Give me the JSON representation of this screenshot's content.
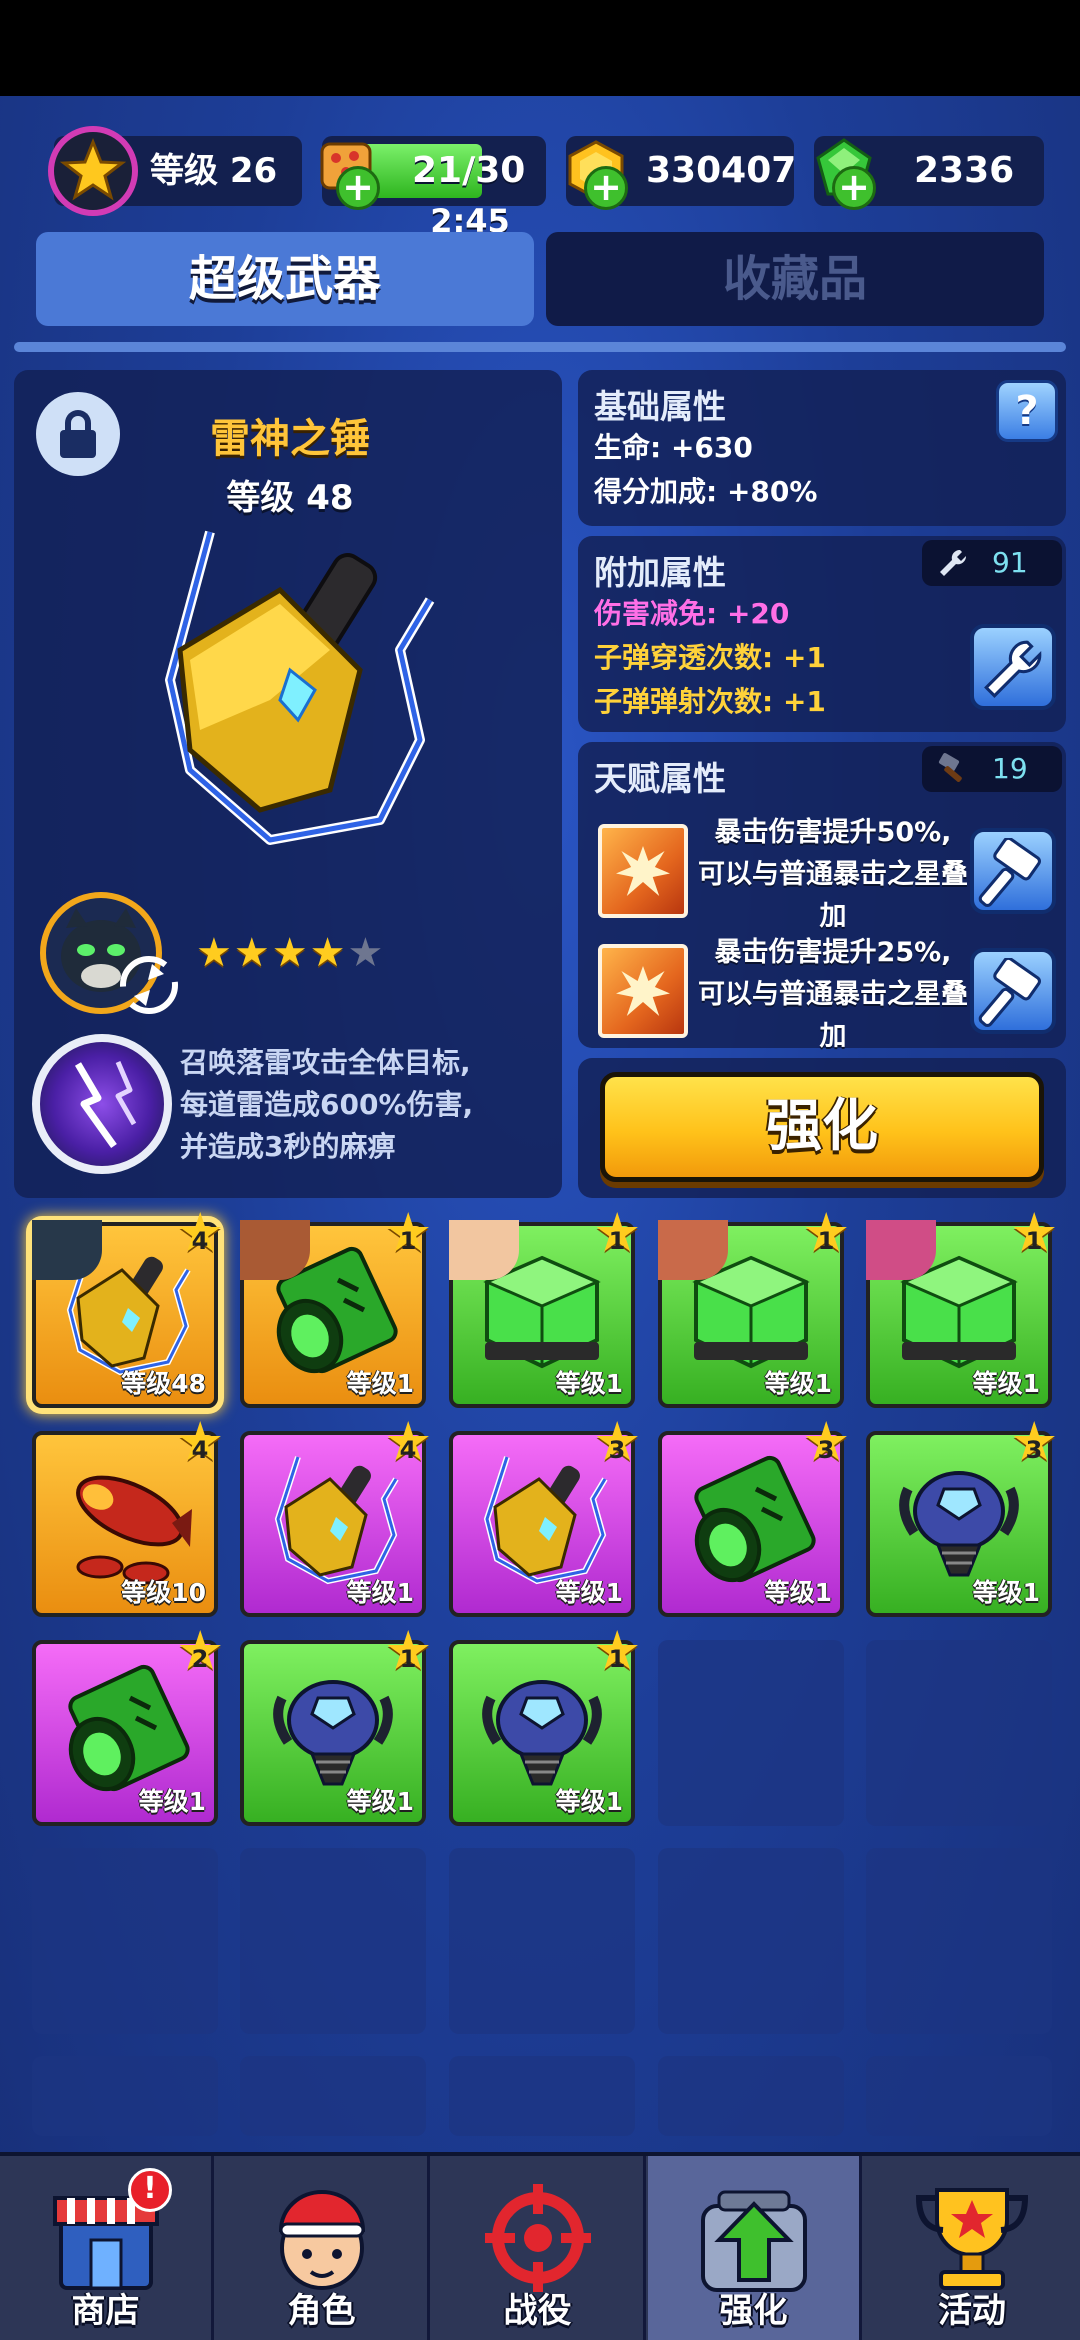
{
  "top_bar": {
    "player_level_label": "等级 26",
    "energy": "21/30",
    "energy_progress": 0.7,
    "energy_timer": "2:45",
    "gold": "330407",
    "gems": "2336"
  },
  "tabs": {
    "super_weapon": "超级武器",
    "collection": "收藏品"
  },
  "weapon": {
    "name": "雷神之锤",
    "level_label": "等级 48",
    "stars_filled": 4,
    "stars_total": 5,
    "skill_lines": [
      "召唤落雷攻击全体目标,",
      "每道雷造成600%伤害,",
      "并造成3秒的麻痹"
    ]
  },
  "base_attrs": {
    "title": "基础属性",
    "help_label": "?",
    "hp": "生命: +630",
    "score_bonus": "得分加成: +80%"
  },
  "extra_attrs": {
    "title": "附加属性",
    "wrench_count": "91",
    "damage_reduction": "伤害减免: +20",
    "pierce": "子弹穿透次数: +1",
    "bounce": "子弹弹射次数: +1"
  },
  "talent_attrs": {
    "title": "天赋属性",
    "hammer_count": "19",
    "talents": [
      {
        "lines": [
          "暴击伤害提升50%,",
          "可以与普通暴击之星叠",
          "加"
        ]
      },
      {
        "lines": [
          "暴击伤害提升25%,",
          "可以与普通暴击之星叠",
          "加"
        ]
      }
    ]
  },
  "upgrade_button": "强化",
  "inventory": [
    {
      "rank": "4",
      "level": "等级48",
      "color": "orange",
      "item": "hammer",
      "face": "panther"
    },
    {
      "rank": "1",
      "level": "等级1",
      "color": "orange",
      "item": "barrel",
      "face": "girl"
    },
    {
      "rank": "1",
      "level": "等级1",
      "color": "green",
      "item": "cube",
      "face": "boy"
    },
    {
      "rank": "1",
      "level": "等级1",
      "color": "green",
      "item": "cube",
      "face": "pirate"
    },
    {
      "rank": "1",
      "level": "等级1",
      "color": "green",
      "item": "cube",
      "face": "punk"
    },
    {
      "rank": "4",
      "level": "等级10",
      "color": "orange",
      "item": "rocket",
      "face": ""
    },
    {
      "rank": "4",
      "level": "等级1",
      "color": "purple",
      "item": "hammer",
      "face": ""
    },
    {
      "rank": "3",
      "level": "等级1",
      "color": "purple",
      "item": "hammer",
      "face": ""
    },
    {
      "rank": "3",
      "level": "等级1",
      "color": "purple",
      "item": "barrel",
      "face": ""
    },
    {
      "rank": "3",
      "level": "等级1",
      "color": "green",
      "item": "pod",
      "face": ""
    },
    {
      "rank": "2",
      "level": "等级1",
      "color": "purple",
      "item": "barrel",
      "face": ""
    },
    {
      "rank": "1",
      "level": "等级1",
      "color": "green",
      "item": "pod",
      "face": ""
    },
    {
      "rank": "1",
      "level": "等级1",
      "color": "green",
      "item": "pod",
      "face": ""
    }
  ],
  "nav": {
    "shop": "商店",
    "shop_badge": "!",
    "character": "角色",
    "campaign": "战役",
    "upgrade": "强化",
    "events": "活动"
  }
}
